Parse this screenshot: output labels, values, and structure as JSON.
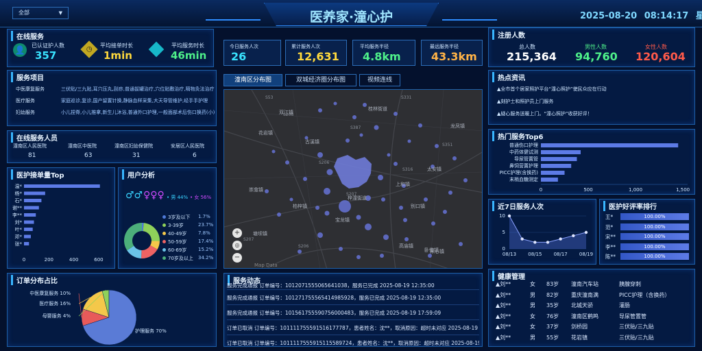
{
  "header": {
    "title": "医养家·潼心护",
    "region": "全部",
    "date": "2025-08-20",
    "time": "08:14:17",
    "weekday": "星期三"
  },
  "online": {
    "title": "在线服务",
    "items": [
      {
        "label": "已认证护人数",
        "value": "357",
        "color": "#39e3ff"
      },
      {
        "label": "平均接单时长",
        "value": "1min",
        "color": "#ffd93d"
      },
      {
        "label": "平均服务时长",
        "value": "46min",
        "color": "#4ef08a"
      }
    ]
  },
  "stats": [
    {
      "label": "今日服务人次",
      "value": "26",
      "color": "#39e3ff"
    },
    {
      "label": "累计服务人次",
      "value": "12,631",
      "color": "#ffd93d"
    },
    {
      "label": "平均服务半径",
      "value": "4.8km",
      "color": "#4ef08a"
    },
    {
      "label": "最远服务半径",
      "value": "43.3km",
      "color": "#ffb347"
    }
  ],
  "register": {
    "title": "注册人数",
    "total_label": "总人数",
    "total": "215,364",
    "male_label": "男性人数",
    "male": "94,760",
    "female_label": "女性人数",
    "female": "120,604"
  },
  "projects": {
    "title": "服务项目",
    "rows": [
      {
        "cat": "中医康复服务",
        "desc": "三伏贴/三九贴,耳穴压丸,刮痧,普通拔罐治疗,穴位贴敷治疗,隔物灸法治疗,足部按摩"
      },
      {
        "cat": "医疗服务",
        "desc": "家庭巡诊,复诊,国产留置针换,静脉血样采集,大天导管维护,经手手护理"
      },
      {
        "cat": "妇幼服务",
        "desc": "小儿捏脊,小儿推拿,新生儿沐浴,普通外口护理,一般面部术后伤口换药(小)"
      }
    ]
  },
  "staff": {
    "title": "在线服务人员",
    "items": [
      {
        "name": "潼南区人民医院",
        "count": "81"
      },
      {
        "name": "潼南区中医院",
        "count": "63"
      },
      {
        "name": "潼南区妇幼保健院",
        "count": "31"
      },
      {
        "name": "安居区人民医院",
        "count": "6"
      }
    ]
  },
  "nurse_top": {
    "title": "医护接单量Top",
    "names": [
      "温*",
      "杨*",
      "石*",
      "谢**",
      "李**",
      "刘*",
      "叶*",
      "邓*",
      "张*"
    ],
    "values": [
      610,
      170,
      140,
      120,
      95,
      80,
      70,
      55,
      40
    ],
    "ticks": [
      "0",
      "200",
      "400",
      "600"
    ],
    "max": 650
  },
  "user": {
    "title": "用户分析",
    "male": "• 男 44%",
    "female": "• 女 56%",
    "ages": [
      {
        "label": "3岁及以下",
        "pct": "1.7%",
        "value": 1.7,
        "color": "#4f7bd9"
      },
      {
        "label": "3-39岁",
        "pct": "23.7%",
        "value": 23.7,
        "color": "#8fd15a"
      },
      {
        "label": "40-49岁",
        "pct": "7.8%",
        "value": 7.8,
        "color": "#f4c84a"
      },
      {
        "label": "50-59岁",
        "pct": "17.4%",
        "value": 17.4,
        "color": "#ee6363"
      },
      {
        "label": "60-69岁",
        "pct": "15.2%",
        "value": 15.2,
        "color": "#6bc3e8"
      },
      {
        "label": "70岁及以上",
        "pct": "34.2%",
        "value": 34.2,
        "color": "#4caf7a"
      }
    ]
  },
  "tabs": [
    "潼南区分布图",
    "双城经济圈分布图",
    "视频连线"
  ],
  "map": {
    "labels": [
      "双江镇",
      "花岩镇",
      "桂林街道",
      "古溪镇",
      "龙凤镇",
      "崇龛镇",
      "塘坝镇",
      "上和镇",
      "梓潼街道",
      "宝龙镇",
      "柏梓镇",
      "别口镇",
      "卧佛镇",
      "高庙镇",
      "太安镇",
      "米心镇"
    ],
    "roads": [
      "S53",
      "S331",
      "S208",
      "S387",
      "S351",
      "S206",
      "S207",
      "S316",
      "S207",
      "S206"
    ],
    "attribution": "Map Data"
  },
  "orders": {
    "title": "订单分布占比",
    "slices": [
      {
        "label": "中医康复服务 10%",
        "value": 10,
        "color": "#e85a5a"
      },
      {
        "label": "医疗服务 16%",
        "value": 16,
        "color": "#f4c84a"
      },
      {
        "label": "母婴服务 4%",
        "value": 4,
        "color": "#8fd15a"
      },
      {
        "label": "护理服务 70%",
        "value": 70,
        "color": "#5a7bd6"
      }
    ]
  },
  "dynamic": {
    "title": "服务动态",
    "rows": [
      "服务完成通报 订单编号：1012071555065641038，服务已完成 2025-08-19 12:35:00",
      "服务完成通报 订单编号：10127175556541498592​8，服务已完成 2025-08-19 12:35:00",
      "服务完成通报 订单编号：10156175559075600048​3，服务已完成 2025-08-19 17:59:09",
      "订单已取消 订单编号：1011117555915161777​87，患者姓名：沈**，取消原因：超时未对应 2025-08-19",
      "订单已取消 订单编号：10111175559151155897​24，患者姓名：沈**，取消原因：超时未对应 2025-08-19"
    ]
  },
  "news": {
    "title": "热点资讯",
    "items": [
      "▲全市首个居家照护平台“潼心照护”使民众应在行动",
      "▲刻护士和照护员上门服务",
      "▲疑心服务送暖上门。“潼心照护”收获好评！"
    ]
  },
  "top6": {
    "title": "热门服务Top6",
    "items": [
      "普通伤口护理",
      "中药体健试测",
      "导尿管置管",
      "鼻饲营置护理",
      "PICC护理(含换药)",
      "末梢血糖测定"
    ],
    "values": [
      1450,
      420,
      380,
      320,
      250,
      180
    ],
    "ticks": [
      "0",
      "500",
      "1,000",
      "1,500"
    ],
    "max": 1550
  },
  "week": {
    "title": "近7日服务人次",
    "x": [
      "08/13",
      "08/14",
      "08/15",
      "08/16",
      "08/17",
      "08/18",
      "08/19"
    ],
    "ticks": [
      "08/13",
      "08/15",
      "08/17",
      "08/19"
    ],
    "y": [
      10,
      3,
      2,
      2,
      3,
      4,
      5
    ],
    "ylabels": [
      "10",
      "5",
      "0"
    ],
    "ymax": 10
  },
  "rating": {
    "title": "医护好评率排行",
    "names": [
      "王*",
      "范*",
      "宋**",
      "李**",
      "陈**"
    ],
    "values": [
      "100.00%",
      "100.00%",
      "100.00%",
      "100.00%",
      "100.00%"
    ]
  },
  "health": {
    "title": "健康管理",
    "rows": [
      [
        "▲刘**",
        "女",
        "83岁",
        "潼南汽车站",
        "胰腺穿刺"
      ],
      [
        "▲刘**",
        "男",
        "82岁",
        "重庆潼南满",
        "PICC护理（含换药）"
      ],
      [
        "▲刘**",
        "男",
        "35岁",
        "北城天骄",
        "灌肠"
      ],
      [
        "▲刘**",
        "女",
        "76岁",
        "潼南区鹤鸣",
        "导尿管置管"
      ],
      [
        "▲刘**",
        "女",
        "37岁",
        "剑桥园",
        "三伏贴/三九贴"
      ],
      [
        "▲刘**",
        "男",
        "55岁",
        "花岩镇",
        "三伏贴/三九贴"
      ]
    ]
  }
}
